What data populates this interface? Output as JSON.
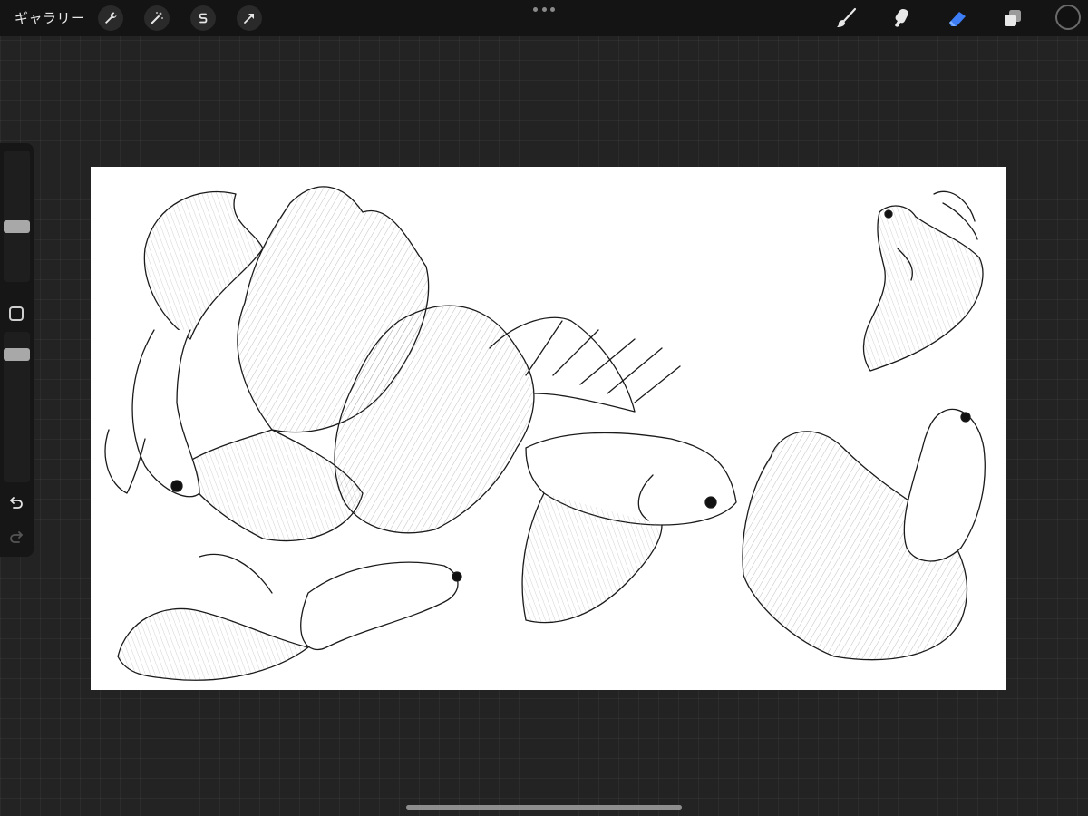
{
  "topbar": {
    "gallery_label": "ギャラリー",
    "left_tools": [
      "wrench-icon",
      "magic-wand-icon",
      "selection-s-icon",
      "transform-arrow-icon"
    ],
    "right_tools": [
      "brush-icon",
      "smudge-icon",
      "eraser-icon",
      "layers-icon"
    ],
    "active_tool": "eraser-icon",
    "accent_color": "#3d7df5",
    "current_color": "#111111"
  },
  "sidebar": {
    "brush_size_level": 0.45,
    "opacity_level": 0.55,
    "buttons": [
      "modify-button",
      "undo-icon",
      "redo-icon"
    ]
  },
  "canvas": {
    "background": "#ffffff",
    "artwork": "betta-fish-line-drawing"
  }
}
